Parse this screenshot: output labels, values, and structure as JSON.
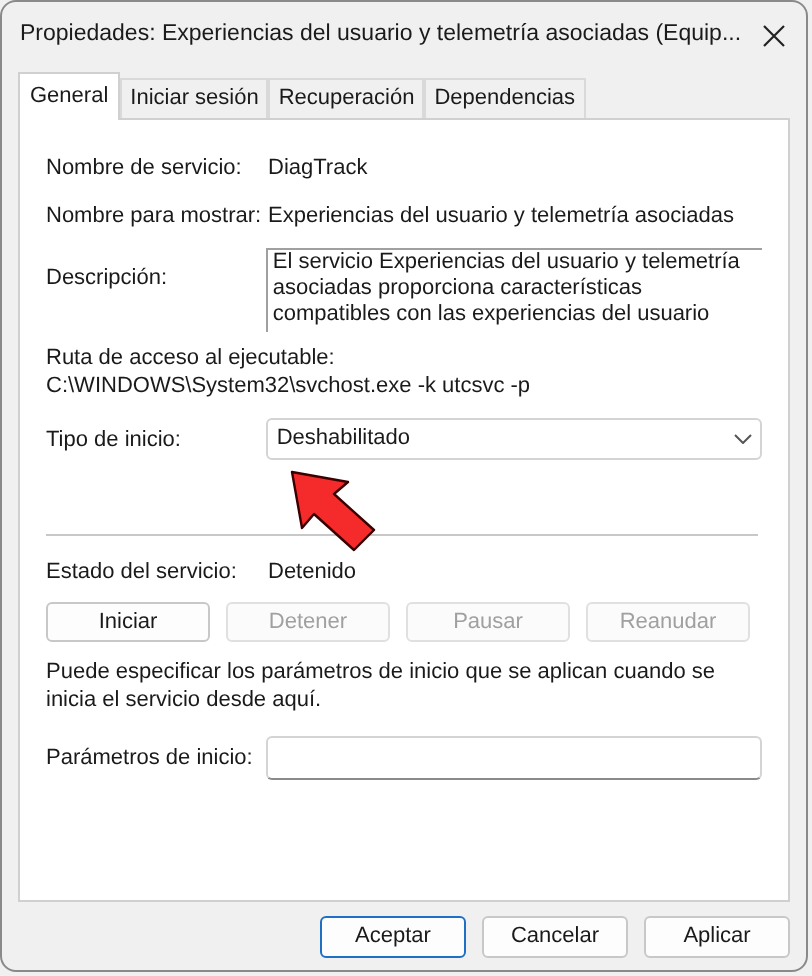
{
  "window": {
    "title": "Propiedades: Experiencias del usuario y telemetría asociadas (Equip..."
  },
  "tabs": [
    {
      "label": "General",
      "selected": true
    },
    {
      "label": "Iniciar sesión",
      "selected": false
    },
    {
      "label": "Recuperación",
      "selected": false
    },
    {
      "label": "Dependencias",
      "selected": false
    }
  ],
  "service_name": {
    "label": "Nombre de servicio:",
    "value": "DiagTrack"
  },
  "display_name": {
    "label": "Nombre para mostrar:",
    "value": "Experiencias del usuario y telemetría asociadas"
  },
  "description": {
    "label": "Descripción:",
    "value": "El servicio Experiencias del usuario y telemetría asociadas proporciona características compatibles con las experiencias del usuario"
  },
  "executable_path": {
    "label": "Ruta de acceso al ejecutable:",
    "value": "C:\\WINDOWS\\System32\\svchost.exe -k utcsvc -p"
  },
  "startup_type": {
    "label": "Tipo de inicio:",
    "value": "Deshabilitado"
  },
  "service_status": {
    "label": "Estado del servicio:",
    "value": "Detenido"
  },
  "service_buttons": [
    {
      "label": "Iniciar",
      "disabled": false
    },
    {
      "label": "Detener",
      "disabled": true
    },
    {
      "label": "Pausar",
      "disabled": true
    },
    {
      "label": "Reanudar",
      "disabled": true
    }
  ],
  "parameters_hint": "Puede especificar los parámetros de inicio que se aplican cuando se inicia el servicio desde aquí.",
  "start_parameters": {
    "label": "Parámetros de inicio:"
  },
  "dialog_buttons": [
    {
      "label": "Aceptar",
      "selected": true
    },
    {
      "label": "Cancelar",
      "selected": false
    },
    {
      "label": "Aplicar",
      "selected": false
    }
  ]
}
